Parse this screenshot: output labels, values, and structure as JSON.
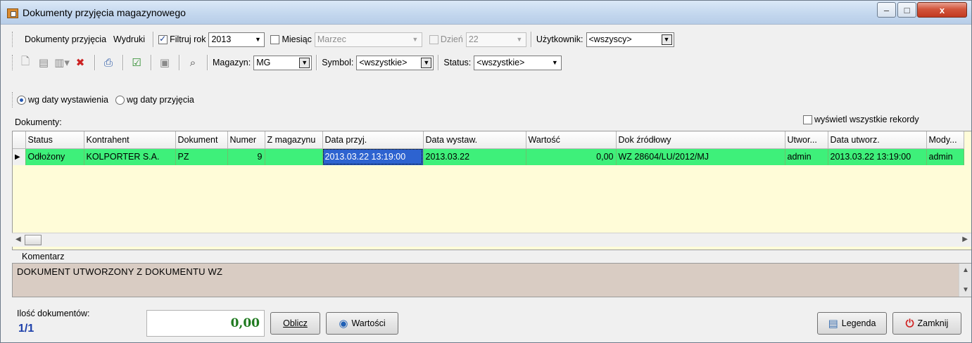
{
  "window": {
    "title": "Dokumenty przyjęcia magazynowego",
    "minimize": "–",
    "maximize": "□",
    "close": "x"
  },
  "menu": {
    "items": [
      "Dokumenty przyjęcia",
      "Wydruki"
    ]
  },
  "filters": {
    "filter_year_label": "Filtruj rok",
    "year_value": "2013",
    "month_label": "Miesiąc",
    "month_value": "Marzec",
    "day_label": "Dzień",
    "day_value": "22",
    "user_label": "Użytkownik:",
    "user_value": "<wszyscy>"
  },
  "toolbar2": {
    "icons": [
      "new-document-icon",
      "edit-document-icon",
      "copy-document-icon",
      "delete-document-icon",
      "print-icon",
      "approve-icon",
      "disabled-icon",
      "search-icon"
    ],
    "warehouse_label": "Magazyn:",
    "warehouse_value": "MG",
    "symbol_label": "Symbol:",
    "symbol_value": "<wszystkie>",
    "status_label": "Status:",
    "status_value": "<wszystkie>"
  },
  "date_mode": {
    "option1": "wg daty wystawienia",
    "option2": "wg daty przyjęcia",
    "selected": "option1"
  },
  "documents": {
    "label": "Dokumenty:",
    "show_all_label": "wyświetl wszystkie rekordy",
    "columns": [
      "Status",
      "Kontrahent",
      "Dokument",
      "Numer",
      "Z magazynu",
      "Data przyj.",
      "Data wystaw.",
      "Wartość",
      "Dok źródłowy",
      "Utwor...",
      "Data utworz.",
      "Mody..."
    ],
    "rows": [
      [
        "Odłożony",
        "KOLPORTER S.A.",
        "PZ",
        "9",
        "",
        "2013.03.22 13:19:00",
        "2013.03.22",
        "0,00",
        "WZ 28604/LU/2012/MJ",
        "admin",
        "2013.03.22 13:19:00",
        "admin"
      ]
    ],
    "row_color": "#3ef07a",
    "grid_bg": "#fffcd8"
  },
  "comment": {
    "label": "Komentarz",
    "text": "DOKUMENT UTWORZONY Z DOKUMENTU WZ"
  },
  "footer": {
    "count_label": "Ilość dokumentów:",
    "count_value": "1/1",
    "sum_value": "0,00",
    "calc_button": "Oblicz",
    "values_button": "Wartości",
    "legend_button": "Legenda",
    "close_button": "Zamknij"
  }
}
